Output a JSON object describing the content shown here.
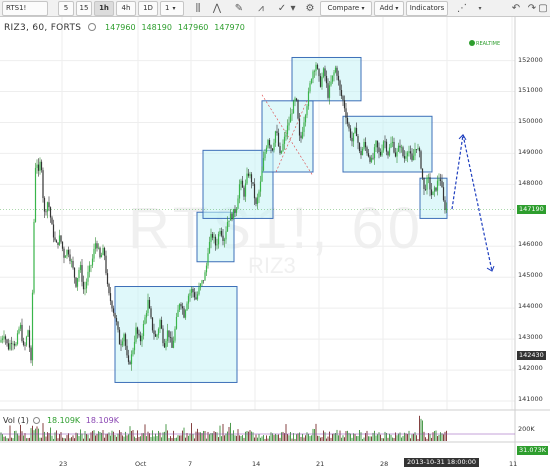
{
  "toolbar": {
    "symbol": "RTS1!",
    "intervals": [
      "5",
      "15",
      "1h",
      "4h",
      "1D",
      "1"
    ],
    "active_interval": "1h",
    "compare_label": "Compare",
    "add_label": "Add",
    "indicators_label": "Indicators"
  },
  "legend": {
    "symbol": "RIZ3, 60, FORTS",
    "open": "147960",
    "high": "148190",
    "low": "147960",
    "close": "147970"
  },
  "realtime_label": "REALTIME",
  "watermark": {
    "main": "RTS1!, 60",
    "sub": "RIZ3"
  },
  "volume": {
    "label": "Vol (1)",
    "v1": "18.109K",
    "v2": "18.109K",
    "axis_label": "200K",
    "last": "31.073K"
  },
  "price_tags": {
    "last": "147190",
    "cross": "142430"
  },
  "time_tag": "2013-10-31 18:00:00",
  "chart_data": {
    "type": "candlestick",
    "y_axis": {
      "ticks": [
        "152000",
        "151000",
        "150000",
        "149000",
        "148000",
        "147000",
        "146000",
        "145000",
        "144000",
        "143000",
        "142000",
        "141000"
      ],
      "ylim": [
        140600,
        152500
      ]
    },
    "x_axis": {
      "ticks": [
        "23",
        "Oct",
        "7",
        "14",
        "21",
        "28",
        "11"
      ]
    },
    "price_path": [
      [
        0,
        142900
      ],
      [
        4,
        143200
      ],
      [
        8,
        142700
      ],
      [
        12,
        143000
      ],
      [
        16,
        142800
      ],
      [
        20,
        143500
      ],
      [
        24,
        142600
      ],
      [
        28,
        143300
      ],
      [
        31,
        142200
      ],
      [
        34,
        146800
      ],
      [
        36,
        149200
      ],
      [
        38,
        148200
      ],
      [
        41,
        148900
      ],
      [
        44,
        147000
      ],
      [
        48,
        147500
      ],
      [
        52,
        146600
      ],
      [
        56,
        146000
      ],
      [
        60,
        146300
      ],
      [
        64,
        145700
      ],
      [
        68,
        145900
      ],
      [
        72,
        145400
      ],
      [
        76,
        144800
      ],
      [
        80,
        145400
      ],
      [
        84,
        144500
      ],
      [
        88,
        145100
      ],
      [
        92,
        145500
      ],
      [
        96,
        146200
      ],
      [
        100,
        145600
      ],
      [
        104,
        145900
      ],
      [
        108,
        144500
      ],
      [
        112,
        144100
      ],
      [
        116,
        143600
      ],
      [
        120,
        142800
      ],
      [
        124,
        143200
      ],
      [
        128,
        142100
      ],
      [
        132,
        142500
      ],
      [
        136,
        143300
      ],
      [
        140,
        142900
      ],
      [
        144,
        143500
      ],
      [
        148,
        144200
      ],
      [
        152,
        143400
      ],
      [
        156,
        143000
      ],
      [
        160,
        143600
      ],
      [
        164,
        142800
      ],
      [
        168,
        143300
      ],
      [
        172,
        142700
      ],
      [
        176,
        143500
      ],
      [
        180,
        144300
      ],
      [
        184,
        143800
      ],
      [
        188,
        144400
      ],
      [
        192,
        144600
      ],
      [
        196,
        144300
      ],
      [
        200,
        144700
      ],
      [
        203,
        144900
      ],
      [
        206,
        145200
      ],
      [
        208,
        145900
      ],
      [
        212,
        146400
      ],
      [
        216,
        146000
      ],
      [
        220,
        146600
      ],
      [
        224,
        146200
      ],
      [
        228,
        146900
      ],
      [
        232,
        147000
      ],
      [
        236,
        147200
      ],
      [
        240,
        148100
      ],
      [
        244,
        147700
      ],
      [
        248,
        148400
      ],
      [
        252,
        148100
      ],
      [
        256,
        147300
      ],
      [
        260,
        147900
      ],
      [
        264,
        148900
      ],
      [
        268,
        149500
      ],
      [
        272,
        149100
      ],
      [
        276,
        149800
      ],
      [
        280,
        148900
      ],
      [
        284,
        149400
      ],
      [
        288,
        149900
      ],
      [
        292,
        150400
      ],
      [
        296,
        150800
      ],
      [
        300,
        149300
      ],
      [
        304,
        150100
      ],
      [
        308,
        150800
      ],
      [
        312,
        151600
      ],
      [
        316,
        151900
      ],
      [
        320,
        151200
      ],
      [
        324,
        151700
      ],
      [
        328,
        150900
      ],
      [
        332,
        151400
      ],
      [
        336,
        151800
      ],
      [
        340,
        151000
      ],
      [
        344,
        150600
      ],
      [
        348,
        149900
      ],
      [
        352,
        149400
      ],
      [
        356,
        149800
      ],
      [
        360,
        148900
      ],
      [
        364,
        149300
      ],
      [
        368,
        149000
      ],
      [
        372,
        148700
      ],
      [
        376,
        149300
      ],
      [
        380,
        148900
      ],
      [
        384,
        149500
      ],
      [
        388,
        149000
      ],
      [
        392,
        149400
      ],
      [
        396,
        148900
      ],
      [
        400,
        149300
      ],
      [
        404,
        148800
      ],
      [
        408,
        149200
      ],
      [
        412,
        148700
      ],
      [
        416,
        149300
      ],
      [
        420,
        148900
      ],
      [
        424,
        147800
      ],
      [
        428,
        148200
      ],
      [
        432,
        147600
      ],
      [
        436,
        147900
      ],
      [
        440,
        148300
      ],
      [
        444,
        147300
      ],
      [
        447,
        147190
      ]
    ],
    "boxes": [
      {
        "x": [
          115,
          237
        ],
        "y": [
          141600,
          144700
        ]
      },
      {
        "x": [
          197,
          234
        ],
        "y": [
          145500,
          147100
        ]
      },
      {
        "x": [
          203,
          273
        ],
        "y": [
          146900,
          149100
        ]
      },
      {
        "x": [
          262,
          313
        ],
        "y": [
          148400,
          150700
        ]
      },
      {
        "x": [
          292,
          361
        ],
        "y": [
          150700,
          152100
        ]
      },
      {
        "x": [
          343,
          432
        ],
        "y": [
          148400,
          150200
        ]
      },
      {
        "x": [
          420,
          447
        ],
        "y": [
          146900,
          148200
        ]
      }
    ],
    "forecast": [
      [
        452,
        147200
      ],
      [
        463,
        149600
      ],
      [
        492,
        145200
      ]
    ],
    "volume": [
      0.25,
      0.6
    ]
  }
}
